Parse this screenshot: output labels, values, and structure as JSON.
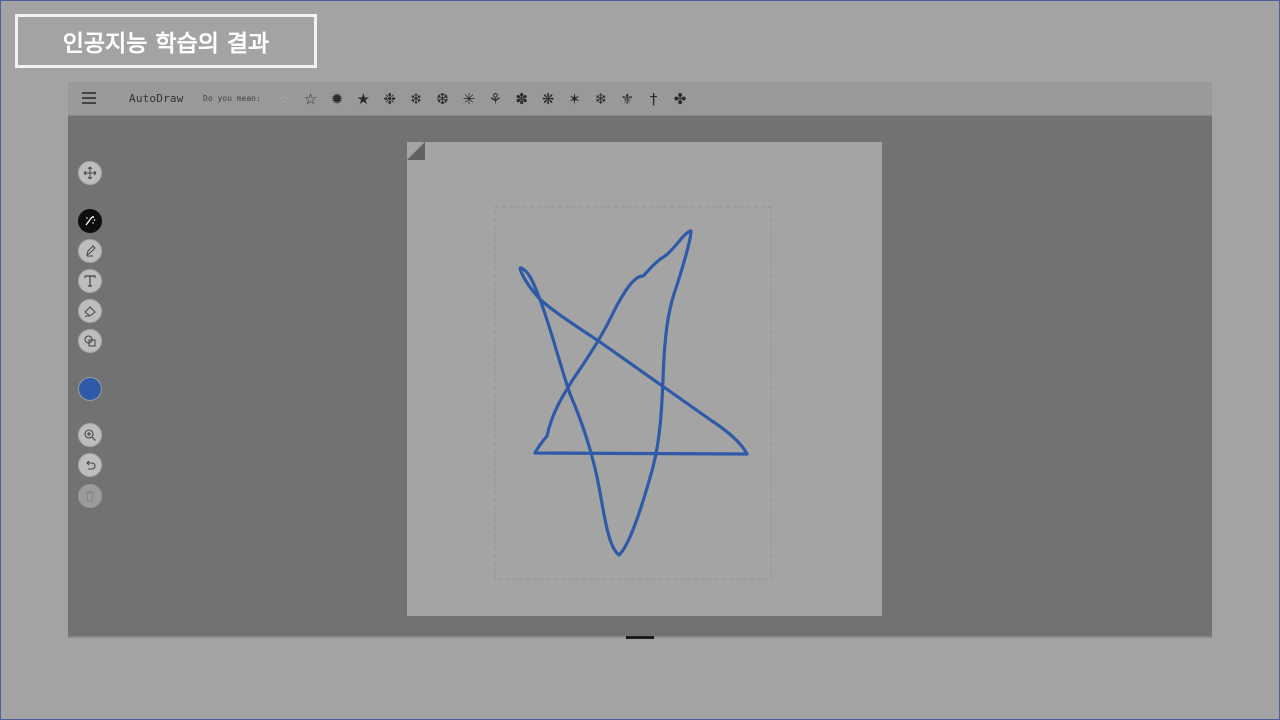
{
  "slide": {
    "title": "인공지능 학습의 결과"
  },
  "app": {
    "name": "AutoDraw",
    "suggest_label": "Do you mean:",
    "suggestions": [
      "☆",
      "☆",
      "✹",
      "★",
      "❉",
      "❄",
      "❆",
      "✳",
      "⚘",
      "✽",
      "❋",
      "✶",
      "❄",
      "⚜",
      "†",
      "✤"
    ],
    "suggestion_icons": [
      "faded-star-icon",
      "star-outline-icon",
      "sun-icon",
      "star-filled-icon",
      "flower-icon",
      "snowflake-icon",
      "snowflake-ornate-icon",
      "starburst-icon",
      "insect-icon",
      "spider-icon",
      "mandala-icon",
      "comet-icon",
      "snowflake-small-icon",
      "windmill-icon",
      "cross-icon",
      "ornament-icon"
    ],
    "tools": {
      "move": "move-icon",
      "autodraw": "autodraw-icon",
      "draw": "pencil-icon",
      "type": "text-icon",
      "fill": "fill-bucket-icon",
      "shape": "shape-icon",
      "zoom": "zoom-in-icon",
      "undo": "undo-icon",
      "delete": "trash-icon"
    },
    "colors": {
      "stroke": "#2f5aa8",
      "selected_color": "#2f5aa8",
      "workspace_bg": "#727272",
      "toolbar_bg": "#999999",
      "canvas_bg": "#a4a4a4"
    }
  }
}
